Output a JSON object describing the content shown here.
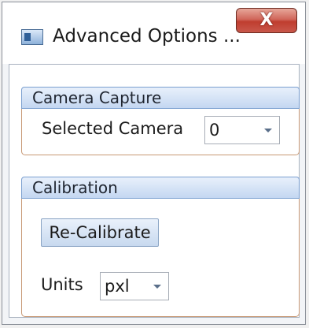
{
  "window": {
    "title": "Advanced Options ...",
    "close_label": "X"
  },
  "camera_group": {
    "header": "Camera Capture",
    "selected_camera_label": "Selected Camera",
    "selected_camera_value": "0"
  },
  "calibration_group": {
    "header": "Calibration",
    "recalibrate_label": "Re-Calibrate",
    "units_label": "Units",
    "units_value": "pxl"
  }
}
